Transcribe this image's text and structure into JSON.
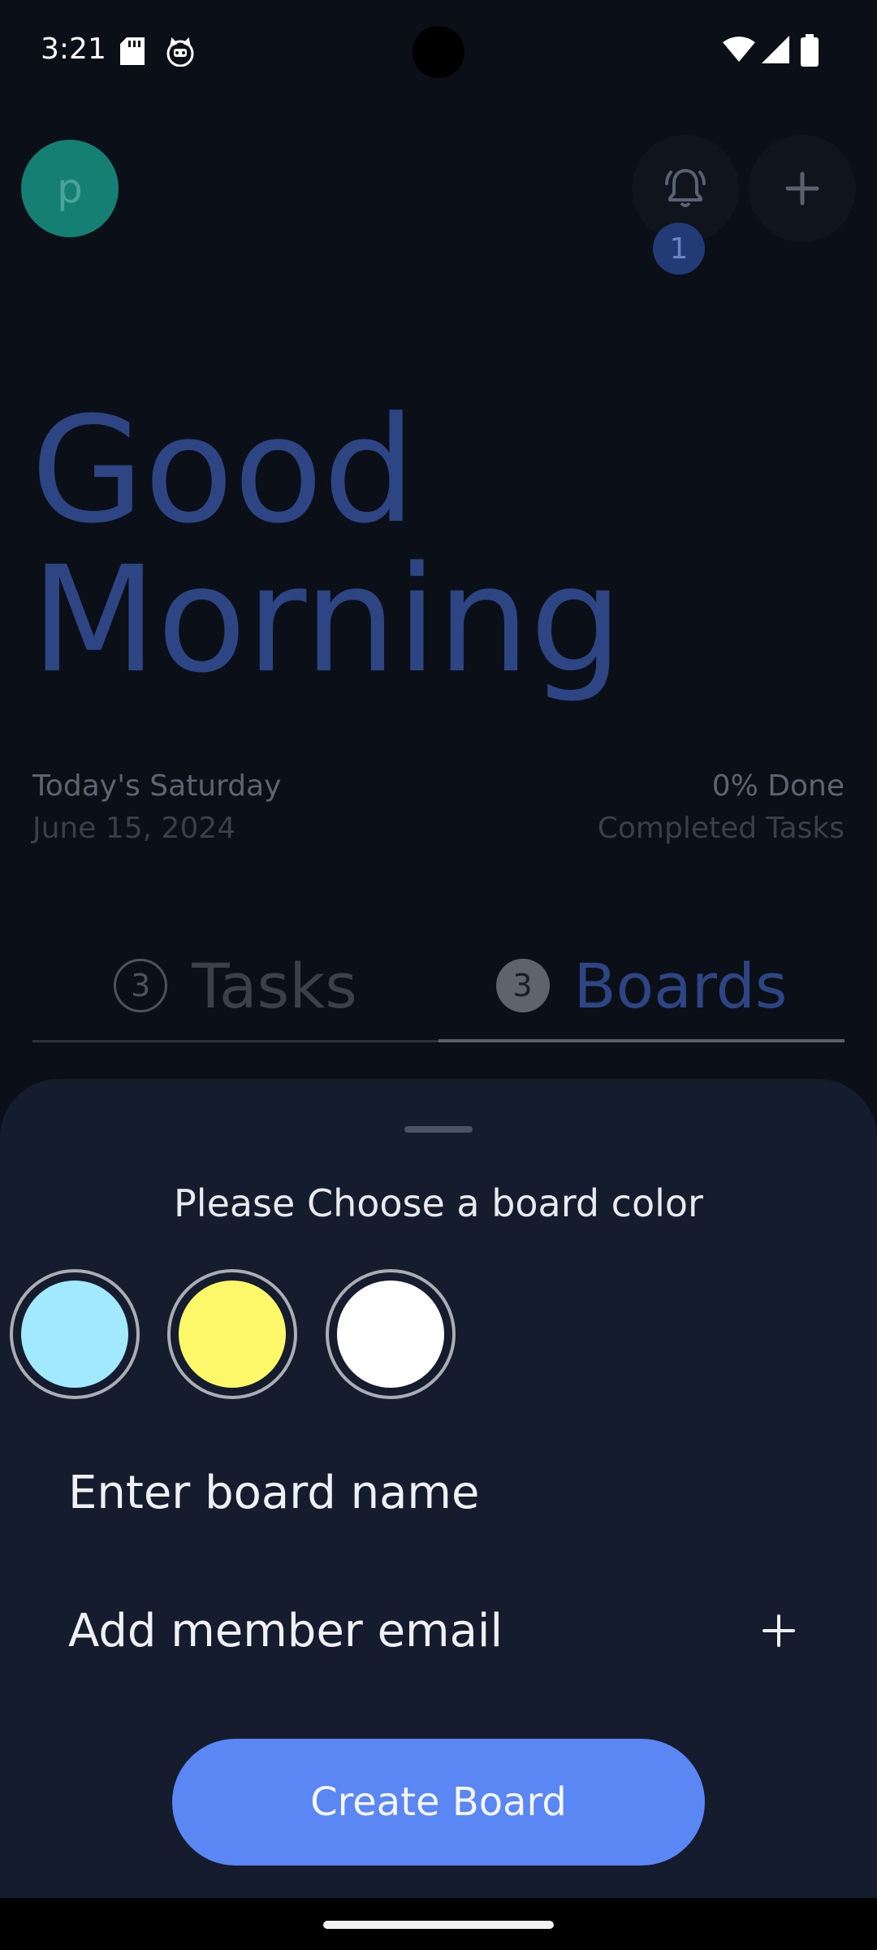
{
  "status_bar": {
    "time": "3:21",
    "icons": [
      "sd-card-icon",
      "cat-icon",
      "wifi-icon",
      "signal-icon",
      "battery-icon"
    ]
  },
  "header": {
    "avatar_letter": "p",
    "notification_count": "1",
    "icons": [
      "bell-icon",
      "plus-icon"
    ],
    "avatar_color": "#167f74"
  },
  "greeting": {
    "line1": "Good",
    "line2": "Morning"
  },
  "summary": {
    "day": "Today's Saturday",
    "date": "June 15, 2024",
    "progress": "0% Done",
    "progress_label": "Completed Tasks"
  },
  "tabs": [
    {
      "count": "3",
      "label": "Tasks"
    },
    {
      "count": "3",
      "label": "Boards"
    }
  ],
  "sheet": {
    "title": "Please Choose a board color",
    "colors": [
      "#a2e9ff",
      "#fdf76a",
      "#ffffff"
    ],
    "board_name_placeholder": "Enter board name",
    "member_email_placeholder": "Add member email",
    "create_button": "Create Board"
  },
  "theme": {
    "accent": "#5b87f4",
    "sheet_bg": "#141c2d",
    "greeting_color": "#2e4584"
  }
}
